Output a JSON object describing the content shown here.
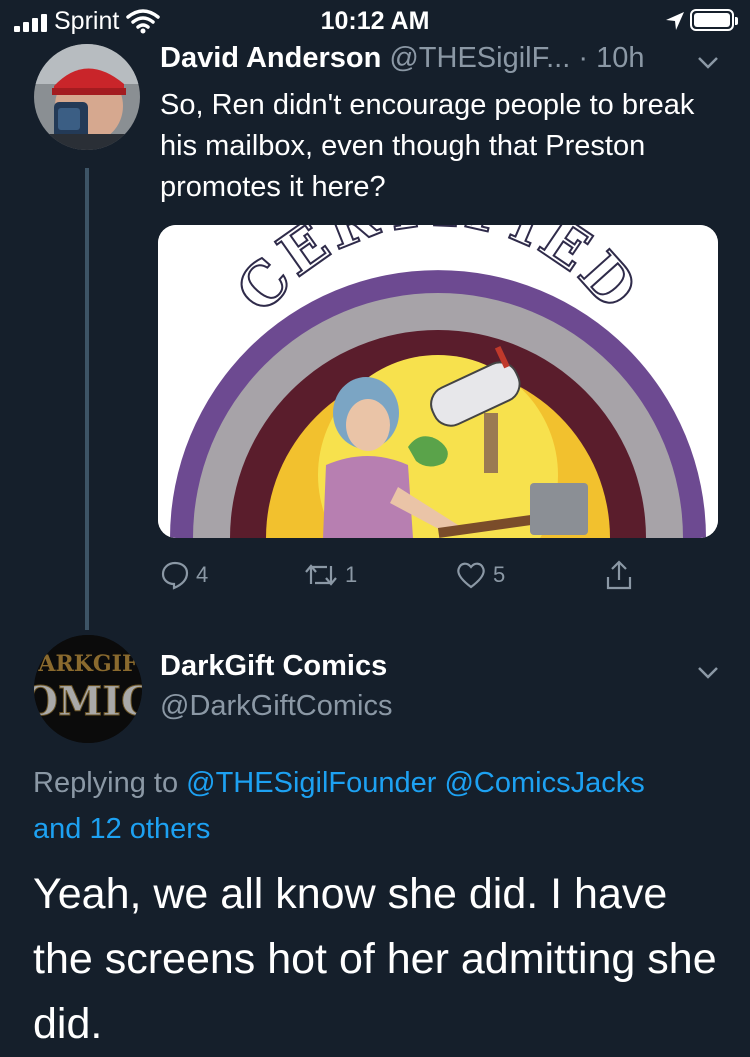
{
  "status_bar": {
    "carrier": "Sprint",
    "time": "10:12 AM"
  },
  "tweet1": {
    "name": "David Anderson",
    "handle": "@THESigilF...",
    "separator": " · ",
    "time": "10h",
    "text": "So, Ren didn't encourage people to break his mailbox, even though that Preston promotes it here?",
    "image_title": "CERTIFIED",
    "counts": {
      "replies": "4",
      "retweets": "1",
      "likes": "5"
    }
  },
  "tweet2": {
    "name": "DarkGift Comics",
    "handle": "@DarkGiftComics",
    "avatar_text_top": "ARKGIF",
    "avatar_text_bottom": "OMIC",
    "replying_prefix": "Replying to ",
    "mention1": "@THESigilFounder",
    "mention2": "@ComicsJacks",
    "others": "and 12 others",
    "text": "Yeah, we all know she did. I have the screens hot of her admitting she did."
  },
  "colors": {
    "background": "#151f2b",
    "muted": "#8b98a5",
    "link": "#1da1f2",
    "thread_line": "#3d5466"
  }
}
